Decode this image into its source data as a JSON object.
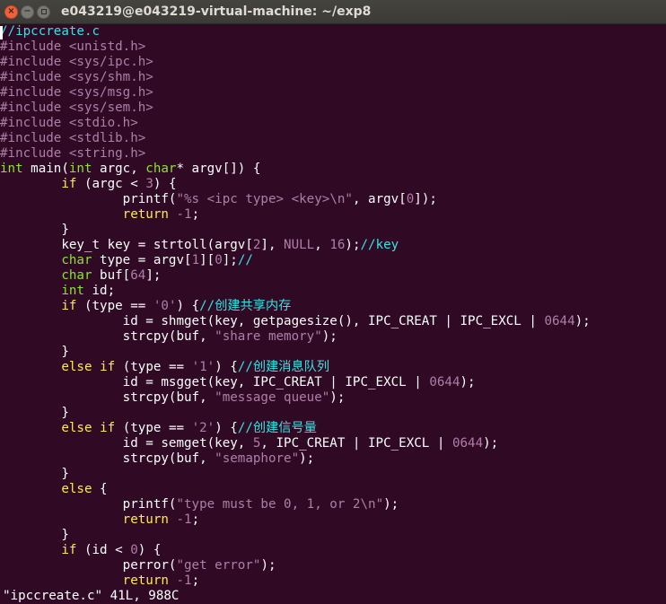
{
  "window": {
    "title": "e043219@e043219-virtual-machine: ~/exp8",
    "controls": {
      "close": "×",
      "minimize": "−",
      "maximize": ""
    }
  },
  "colors": {
    "background": "#300a24",
    "comment": "#34e2e2",
    "preproc": "#ad7fa8",
    "keyword": "#fce94f",
    "type": "#8ae234",
    "constant": "#ad7fa8",
    "text": "#ffffff"
  },
  "editor": {
    "lines": [
      [
        [
          "comment",
          "//ipccreate.c"
        ]
      ],
      [
        [
          "pre",
          "#include "
        ],
        [
          "inc",
          "<unistd.h>"
        ]
      ],
      [
        [
          "pre",
          "#include "
        ],
        [
          "inc",
          "<sys/ipc.h>"
        ]
      ],
      [
        [
          "pre",
          "#include "
        ],
        [
          "inc",
          "<sys/shm.h>"
        ]
      ],
      [
        [
          "pre",
          "#include "
        ],
        [
          "inc",
          "<sys/msg.h>"
        ]
      ],
      [
        [
          "pre",
          "#include "
        ],
        [
          "inc",
          "<sys/sem.h>"
        ]
      ],
      [
        [
          "pre",
          "#include "
        ],
        [
          "inc",
          "<stdio.h>"
        ]
      ],
      [
        [
          "pre",
          "#include "
        ],
        [
          "inc",
          "<stdlib.h>"
        ]
      ],
      [
        [
          "pre",
          "#include "
        ],
        [
          "inc",
          "<string.h>"
        ]
      ],
      [
        [
          "type",
          "int"
        ],
        [
          "plain",
          " main("
        ],
        [
          "type",
          "int"
        ],
        [
          "plain",
          " argc, "
        ],
        [
          "type",
          "char"
        ],
        [
          "plain",
          "* argv[]) {"
        ]
      ],
      [
        [
          "plain",
          "        "
        ],
        [
          "kw",
          "if"
        ],
        [
          "plain",
          " (argc < "
        ],
        [
          "num",
          "3"
        ],
        [
          "plain",
          ") {"
        ]
      ],
      [
        [
          "plain",
          "                printf("
        ],
        [
          "str",
          "\"%s <ipc type> <key>"
        ],
        [
          "esc",
          "\\n"
        ],
        [
          "str",
          "\""
        ],
        [
          "plain",
          ", argv["
        ],
        [
          "num",
          "0"
        ],
        [
          "plain",
          "]);"
        ]
      ],
      [
        [
          "plain",
          "                "
        ],
        [
          "kw",
          "return"
        ],
        [
          "plain",
          " "
        ],
        [
          "num",
          "-1"
        ],
        [
          "plain",
          ";"
        ]
      ],
      [
        [
          "plain",
          "        }"
        ]
      ],
      [
        [
          "plain",
          "        key_t key = strtoll(argv["
        ],
        [
          "num",
          "2"
        ],
        [
          "plain",
          "], "
        ],
        [
          "num",
          "NULL"
        ],
        [
          "plain",
          ", "
        ],
        [
          "num",
          "16"
        ],
        [
          "plain",
          ");"
        ],
        [
          "comment",
          "//key"
        ]
      ],
      [
        [
          "plain",
          "        "
        ],
        [
          "type",
          "char"
        ],
        [
          "plain",
          " type = argv["
        ],
        [
          "num",
          "1"
        ],
        [
          "plain",
          "]["
        ],
        [
          "num",
          "0"
        ],
        [
          "plain",
          "];"
        ],
        [
          "comment",
          "//"
        ]
      ],
      [
        [
          "plain",
          "        "
        ],
        [
          "type",
          "char"
        ],
        [
          "plain",
          " buf["
        ],
        [
          "num",
          "64"
        ],
        [
          "plain",
          "];"
        ]
      ],
      [
        [
          "plain",
          "        "
        ],
        [
          "type",
          "int"
        ],
        [
          "plain",
          " id;"
        ]
      ],
      [
        [
          "plain",
          "        "
        ],
        [
          "kw",
          "if"
        ],
        [
          "plain",
          " (type == "
        ],
        [
          "str",
          "'0'"
        ],
        [
          "plain",
          ") {"
        ],
        [
          "comment",
          "//创建共享内存"
        ]
      ],
      [
        [
          "plain",
          "                id = shmget(key, getpagesize(), IPC_CREAT | IPC_EXCL | "
        ],
        [
          "num",
          "0644"
        ],
        [
          "plain",
          ");"
        ]
      ],
      [
        [
          "plain",
          "                strcpy(buf, "
        ],
        [
          "str",
          "\"share memory\""
        ],
        [
          "plain",
          ");"
        ]
      ],
      [
        [
          "plain",
          "        }"
        ]
      ],
      [
        [
          "plain",
          "        "
        ],
        [
          "kw",
          "else"
        ],
        [
          "plain",
          " "
        ],
        [
          "kw",
          "if"
        ],
        [
          "plain",
          " (type == "
        ],
        [
          "str",
          "'1'"
        ],
        [
          "plain",
          ") {"
        ],
        [
          "comment",
          "//创建消息队列"
        ]
      ],
      [
        [
          "plain",
          "                id = msgget(key, IPC_CREAT | IPC_EXCL | "
        ],
        [
          "num",
          "0644"
        ],
        [
          "plain",
          ");"
        ]
      ],
      [
        [
          "plain",
          "                strcpy(buf, "
        ],
        [
          "str",
          "\"message queue\""
        ],
        [
          "plain",
          ");"
        ]
      ],
      [
        [
          "plain",
          "        }"
        ]
      ],
      [
        [
          "plain",
          "        "
        ],
        [
          "kw",
          "else"
        ],
        [
          "plain",
          " "
        ],
        [
          "kw",
          "if"
        ],
        [
          "plain",
          " (type == "
        ],
        [
          "str",
          "'2'"
        ],
        [
          "plain",
          ") {"
        ],
        [
          "comment",
          "//创建信号量"
        ]
      ],
      [
        [
          "plain",
          "                id = semget(key, "
        ],
        [
          "num",
          "5"
        ],
        [
          "plain",
          ", IPC_CREAT | IPC_EXCL | "
        ],
        [
          "num",
          "0644"
        ],
        [
          "plain",
          ");"
        ]
      ],
      [
        [
          "plain",
          "                strcpy(buf, "
        ],
        [
          "str",
          "\"semaphore\""
        ],
        [
          "plain",
          ");"
        ]
      ],
      [
        [
          "plain",
          "        }"
        ]
      ],
      [
        [
          "plain",
          "        "
        ],
        [
          "kw",
          "else"
        ],
        [
          "plain",
          " {"
        ]
      ],
      [
        [
          "plain",
          "                printf("
        ],
        [
          "str",
          "\"type must be 0, 1, or 2"
        ],
        [
          "esc",
          "\\n"
        ],
        [
          "str",
          "\""
        ],
        [
          "plain",
          ");"
        ]
      ],
      [
        [
          "plain",
          "                "
        ],
        [
          "kw",
          "return"
        ],
        [
          "plain",
          " "
        ],
        [
          "num",
          "-1"
        ],
        [
          "plain",
          ";"
        ]
      ],
      [
        [
          "plain",
          "        }"
        ]
      ],
      [
        [
          "plain",
          "        "
        ],
        [
          "kw",
          "if"
        ],
        [
          "plain",
          " (id < "
        ],
        [
          "num",
          "0"
        ],
        [
          "plain",
          ") {"
        ]
      ],
      [
        [
          "plain",
          "                perror("
        ],
        [
          "str",
          "\"get error\""
        ],
        [
          "plain",
          ");"
        ]
      ],
      [
        [
          "plain",
          "                "
        ],
        [
          "kw",
          "return"
        ],
        [
          "plain",
          " "
        ],
        [
          "num",
          "-1"
        ],
        [
          "plain",
          ";"
        ]
      ]
    ],
    "status_line": "\"ipccreate.c\" 41L, 988C"
  }
}
